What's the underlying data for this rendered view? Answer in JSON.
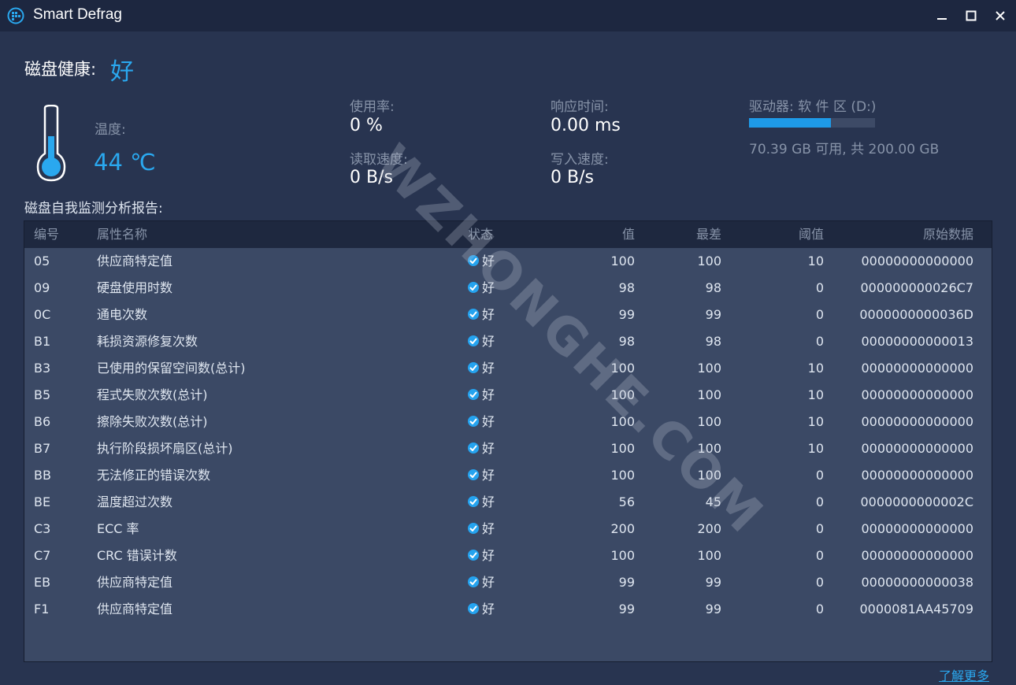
{
  "window": {
    "title": "Smart Defrag"
  },
  "health": {
    "label": "磁盘健康:",
    "value": "好"
  },
  "temperature": {
    "label": "温度:",
    "value": "44 ℃"
  },
  "stats": {
    "usage_label": "使用率:",
    "usage_value": "0 %",
    "response_label": "响应时间:",
    "response_value": "0.00 ms",
    "read_label": "读取速度:",
    "read_value": "0 B/s",
    "write_label": "写入速度:",
    "write_value": "0 B/s"
  },
  "drive": {
    "label": "驱动器: 软 件 区 (D:)",
    "used_fraction": 0.65,
    "caption": "70.39 GB 可用, 共 200.00 GB"
  },
  "report": {
    "title": "磁盘自我监测分析报告:",
    "columns": {
      "code": "编号",
      "name": "属性名称",
      "status": "状态",
      "value": "值",
      "worst": "最差",
      "threshold": "阈值",
      "raw": "原始数据"
    },
    "rows": [
      {
        "code": "05",
        "name": "供应商特定值",
        "status": "好",
        "value": "100",
        "worst": "100",
        "threshold": "10",
        "raw": "00000000000000"
      },
      {
        "code": "09",
        "name": "硬盘使用时数",
        "status": "好",
        "value": "98",
        "worst": "98",
        "threshold": "0",
        "raw": "000000000026C7"
      },
      {
        "code": "0C",
        "name": "通电次数",
        "status": "好",
        "value": "99",
        "worst": "99",
        "threshold": "0",
        "raw": "0000000000036D"
      },
      {
        "code": "B1",
        "name": "耗损资源修复次数",
        "status": "好",
        "value": "98",
        "worst": "98",
        "threshold": "0",
        "raw": "00000000000013"
      },
      {
        "code": "B3",
        "name": "已使用的保留空间数(总计)",
        "status": "好",
        "value": "100",
        "worst": "100",
        "threshold": "10",
        "raw": "00000000000000"
      },
      {
        "code": "B5",
        "name": "程式失败次数(总计)",
        "status": "好",
        "value": "100",
        "worst": "100",
        "threshold": "10",
        "raw": "00000000000000"
      },
      {
        "code": "B6",
        "name": "擦除失败次数(总计)",
        "status": "好",
        "value": "100",
        "worst": "100",
        "threshold": "10",
        "raw": "00000000000000"
      },
      {
        "code": "B7",
        "name": "执行阶段损坏扇区(总计)",
        "status": "好",
        "value": "100",
        "worst": "100",
        "threshold": "10",
        "raw": "00000000000000"
      },
      {
        "code": "BB",
        "name": "无法修正的错误次数",
        "status": "好",
        "value": "100",
        "worst": "100",
        "threshold": "0",
        "raw": "00000000000000"
      },
      {
        "code": "BE",
        "name": "温度超过次数",
        "status": "好",
        "value": "56",
        "worst": "45",
        "threshold": "0",
        "raw": "0000000000002C"
      },
      {
        "code": "C3",
        "name": "ECC 率",
        "status": "好",
        "value": "200",
        "worst": "200",
        "threshold": "0",
        "raw": "00000000000000"
      },
      {
        "code": "C7",
        "name": "CRC 错误计数",
        "status": "好",
        "value": "100",
        "worst": "100",
        "threshold": "0",
        "raw": "00000000000000"
      },
      {
        "code": "EB",
        "name": "供应商特定值",
        "status": "好",
        "value": "99",
        "worst": "99",
        "threshold": "0",
        "raw": "00000000000038"
      },
      {
        "code": "F1",
        "name": "供应商特定值",
        "status": "好",
        "value": "99",
        "worst": "99",
        "threshold": "0",
        "raw": "0000081AA45709"
      }
    ]
  },
  "footer": {
    "learn_more": "了解更多"
  },
  "watermark": "WZHONGHE.COM",
  "colors": {
    "accent": "#2aa8ef",
    "background": "#283450",
    "titlebar": "#1d2740",
    "table_header": "#1e283f",
    "table_body": "#3b4965"
  },
  "icons": {
    "app": "smart-defrag-logo-icon",
    "minimize": "minimize-icon",
    "maximize": "maximize-icon",
    "close": "close-icon",
    "thermometer": "thermometer-icon",
    "status": "check-circle-icon"
  }
}
